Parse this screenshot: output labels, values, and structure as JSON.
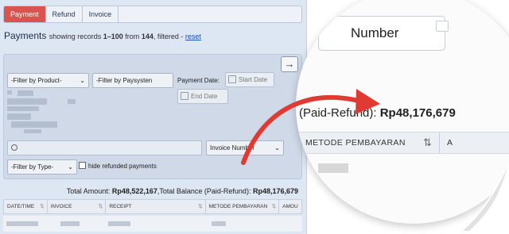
{
  "tabs": [
    {
      "label": "Payment",
      "active": true
    },
    {
      "label": "Refund",
      "active": false
    },
    {
      "label": "Invoice",
      "active": false
    }
  ],
  "heading": {
    "title": "Payments",
    "showing_prefix": "showing records",
    "range": "1–100",
    "from_word": "from",
    "total": "144",
    "suffix": ", filtered -",
    "reset_link": "reset"
  },
  "filters": {
    "product": "-Filter by Product-",
    "paysystem": "-Filter by Paysysten",
    "payment_date_label": "Payment Date:",
    "start_date": "Start Date",
    "end_date": "End Date",
    "invoice_select": "Invoice Number",
    "type": "-Filter by Type-",
    "hide_refunded_label": "hide refunded payments"
  },
  "totals": {
    "total_amount_label": "Total Amount:",
    "total_amount": "Rp48,522,167",
    "total_balance_label": ",Total Balance (Paid-Refund):",
    "total_balance": "Rp48,176,679"
  },
  "table": {
    "columns": [
      "DATE/TIME",
      "INVOICE",
      "RECEIPT",
      "METODE PEMBAYARAN",
      "AMOU"
    ]
  },
  "zoom": {
    "button_label": "Number",
    "balance_prefix": "(Paid-Refund):",
    "balance_value": "Rp48,176,679",
    "column_label": "METODE PEMBAYARAN",
    "column_next": "A",
    "sort_glyph": "⇅"
  },
  "colors": {
    "active_tab": "#d9534f",
    "panel_bg": "#dde6f3",
    "arrow": "#e03a32",
    "link": "#1a4fb5"
  },
  "icons": [
    "arrow-right-icon",
    "calendar-icon",
    "search-icon",
    "sort-icon",
    "caret-down-icon",
    "curved-arrow-icon"
  ]
}
